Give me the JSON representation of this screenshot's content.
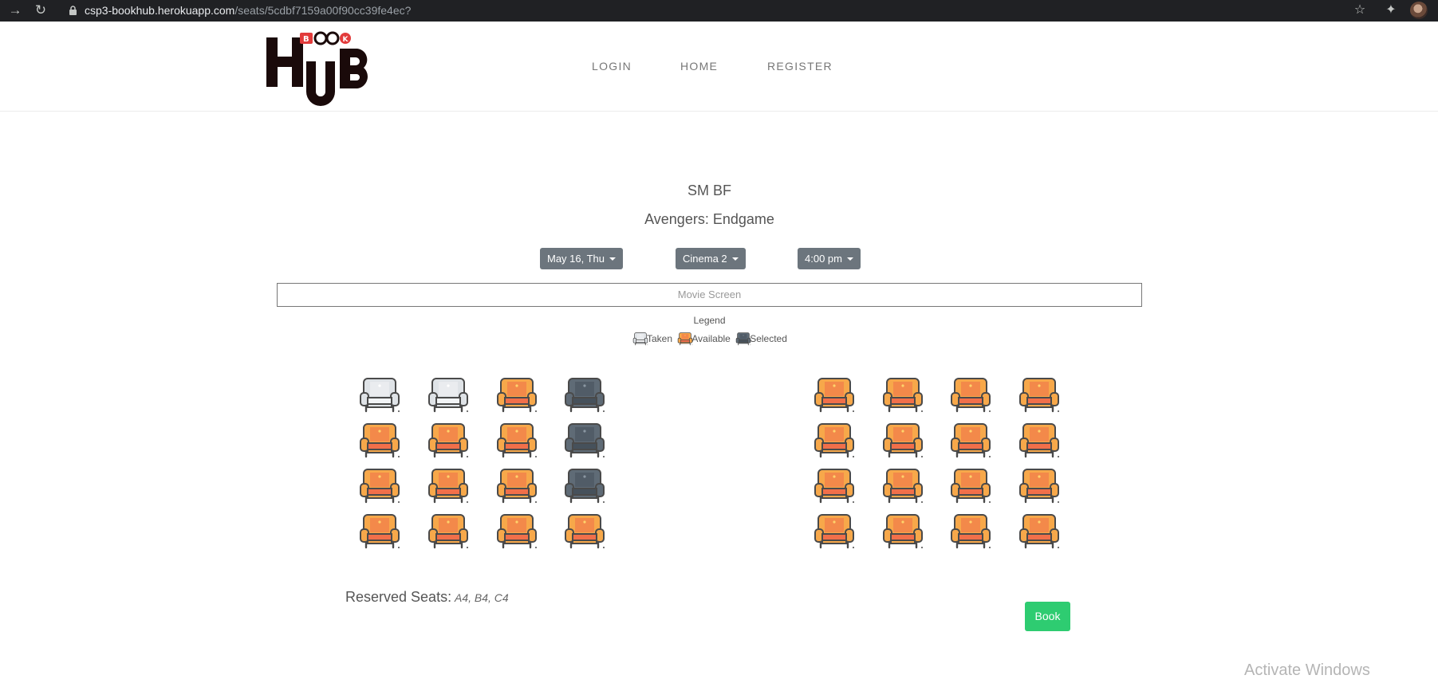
{
  "browser": {
    "url_host": "csp3-bookhub.herokuapp.com",
    "url_path": "/seats/5cdbf7159a00f90cc39fe4ec?"
  },
  "header": {
    "logo_text": "BOOK HUB",
    "nav": [
      "LOGIN",
      "HOME",
      "REGISTER"
    ]
  },
  "booking": {
    "cinema": "SM BF",
    "movie": "Avengers: Endgame",
    "date": "May 16, Thu",
    "hall": "Cinema 2",
    "time": "4:00 pm",
    "screen_label": "Movie Screen"
  },
  "legend": {
    "title": "Legend",
    "items": [
      {
        "label": "Taken",
        "status": "taken"
      },
      {
        "label": "Available",
        "status": "available"
      },
      {
        "label": "Selected",
        "status": "selected"
      }
    ]
  },
  "colors": {
    "taken": "#dfe3e7",
    "available": "#f7a84a",
    "available_cushion": "#f16f4a",
    "selected": "#5f6b76",
    "outline": "#4a4a4a",
    "book_button": "#2ecc71",
    "dropdown": "#6c757d"
  },
  "seats": {
    "left_block": [
      [
        "taken",
        "taken",
        "available",
        "selected"
      ],
      [
        "available",
        "available",
        "available",
        "selected"
      ],
      [
        "available",
        "available",
        "available",
        "selected"
      ],
      [
        "available",
        "available",
        "available",
        "available"
      ]
    ],
    "right_block": [
      [
        "available",
        "available",
        "available",
        "available"
      ],
      [
        "available",
        "available",
        "available",
        "available"
      ],
      [
        "available",
        "available",
        "available",
        "available"
      ],
      [
        "available",
        "available",
        "available",
        "available"
      ]
    ]
  },
  "reserved": {
    "label": "Reserved Seats:",
    "value": "A4, B4, C4"
  },
  "book_label": "Book",
  "watermark": "Activate Windows"
}
